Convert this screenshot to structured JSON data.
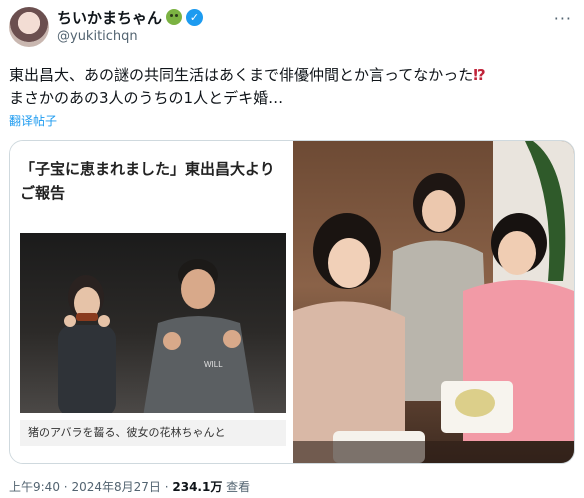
{
  "author": {
    "display_name": "ちいかまちゃん",
    "handle": "@yukitichqn",
    "status_emoji": "green-face-emoji",
    "verified_icon": "verified-check-icon"
  },
  "tweet": {
    "line1": "東出昌大、あの謎の共同生活はあくまで俳優仲間とか言ってなかった",
    "line1_end": "⁉",
    "line2": "まさかのあの3人のうちの1人とデキ婚…",
    "translate_link": "翻译帖子"
  },
  "media": {
    "card": {
      "headline": "「子宝に恵まれました」東出昌大よりご報告",
      "caption": "猪のアバラを齧る、彼女の花林ちゃんと",
      "shirt_text": "WILL"
    }
  },
  "meta": {
    "time": "上午9:40",
    "separator": "·",
    "date": "2024年8月27日",
    "views": "234.1万",
    "views_label": "查看"
  },
  "colors": {
    "accent": "#1d9bf0",
    "text": "#0f1419",
    "muted": "#536471"
  }
}
